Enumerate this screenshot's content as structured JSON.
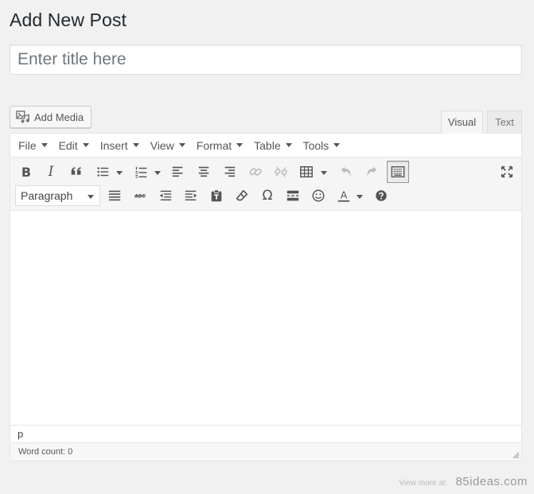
{
  "page": {
    "title": "Add New Post"
  },
  "title_field": {
    "placeholder": "Enter title here",
    "value": ""
  },
  "media": {
    "add_media_label": "Add Media"
  },
  "tabs": [
    {
      "label": "Visual",
      "active": true
    },
    {
      "label": "Text",
      "active": false
    }
  ],
  "menubar": [
    {
      "label": "File"
    },
    {
      "label": "Edit"
    },
    {
      "label": "Insert"
    },
    {
      "label": "View"
    },
    {
      "label": "Format"
    },
    {
      "label": "Table"
    },
    {
      "label": "Tools"
    }
  ],
  "toolbar": {
    "bold_glyph": "B",
    "italic_glyph": "I",
    "omega_glyph": "Ω",
    "text_color_glyph": "A",
    "format_select_value": "Paragraph"
  },
  "path": {
    "value": "p"
  },
  "status": {
    "word_count": "Word count: 0"
  },
  "watermark": {
    "label": "View more at:",
    "site": "85ideas.com"
  },
  "colors": {
    "background": "#f1f1f1",
    "toolbar": "#f5f5f5",
    "border": "#e5e5e5",
    "icon": "#555555",
    "icon_disabled": "#bbbbbb"
  }
}
